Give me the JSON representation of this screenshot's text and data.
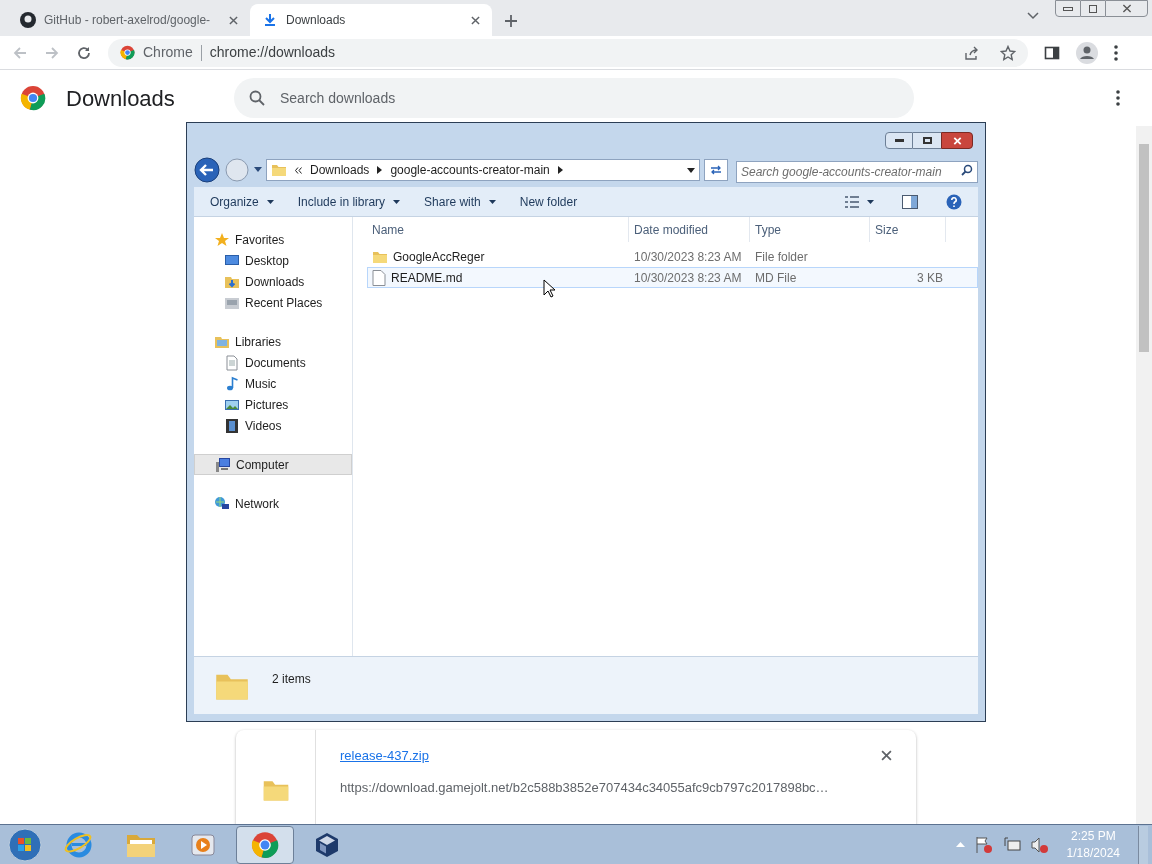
{
  "browser": {
    "tabs": [
      {
        "title": "GitHub - robert-axelrod/google-",
        "selected": false
      },
      {
        "title": "Downloads",
        "selected": true
      }
    ],
    "address": {
      "site_label": "Chrome",
      "url": "chrome://downloads"
    }
  },
  "downloads_page": {
    "title": "Downloads",
    "search": {
      "placeholder": "Search downloads"
    },
    "items": [
      {
        "file_name": "release-437.zip",
        "url": "https://download.gamejolt.net/b2c588b3852e707434c34055afc9cb797c2017898bc…"
      }
    ]
  },
  "explorer": {
    "breadcrumb": [
      "Downloads",
      "google-accounts-creator-main"
    ],
    "search": {
      "placeholder": "Search google-accounts-creator-main"
    },
    "toolbar": [
      {
        "label": "Organize",
        "menu": true
      },
      {
        "label": "Include in library",
        "menu": true
      },
      {
        "label": "Share with",
        "menu": true
      },
      {
        "label": "New folder",
        "menu": false
      }
    ],
    "nav": [
      {
        "label": "Favorites",
        "selected": false,
        "children": [
          {
            "label": "Desktop",
            "selected": false
          },
          {
            "label": "Downloads",
            "selected": false
          },
          {
            "label": "Recent Places",
            "selected": false
          }
        ]
      },
      {
        "label": "Libraries",
        "selected": false,
        "children": [
          {
            "label": "Documents",
            "selected": false
          },
          {
            "label": "Music",
            "selected": false
          },
          {
            "label": "Pictures",
            "selected": false
          },
          {
            "label": "Videos",
            "selected": false
          }
        ]
      },
      {
        "label": "Computer",
        "selected": true
      },
      {
        "label": "Network",
        "selected": false
      }
    ],
    "columns": [
      "Name",
      "Date modified",
      "Type",
      "Size"
    ],
    "rows": [
      {
        "name": "GoogleAccReger",
        "kind": "folder",
        "date": "10/30/2023 8:23 AM",
        "type": "File folder",
        "hovered": false
      },
      {
        "name": "README.md",
        "kind": "file",
        "date": "10/30/2023 8:23 AM",
        "type": "MD File",
        "size": "3 KB",
        "hovered": true
      }
    ],
    "status": "2 items"
  },
  "taskbar": {
    "apps": [
      {
        "selected": false
      },
      {
        "selected": false
      },
      {
        "selected": false
      },
      {
        "selected": true
      },
      {
        "selected": false
      }
    ],
    "clock": {
      "time": "2:25 PM",
      "date": "1/18/2024"
    }
  }
}
